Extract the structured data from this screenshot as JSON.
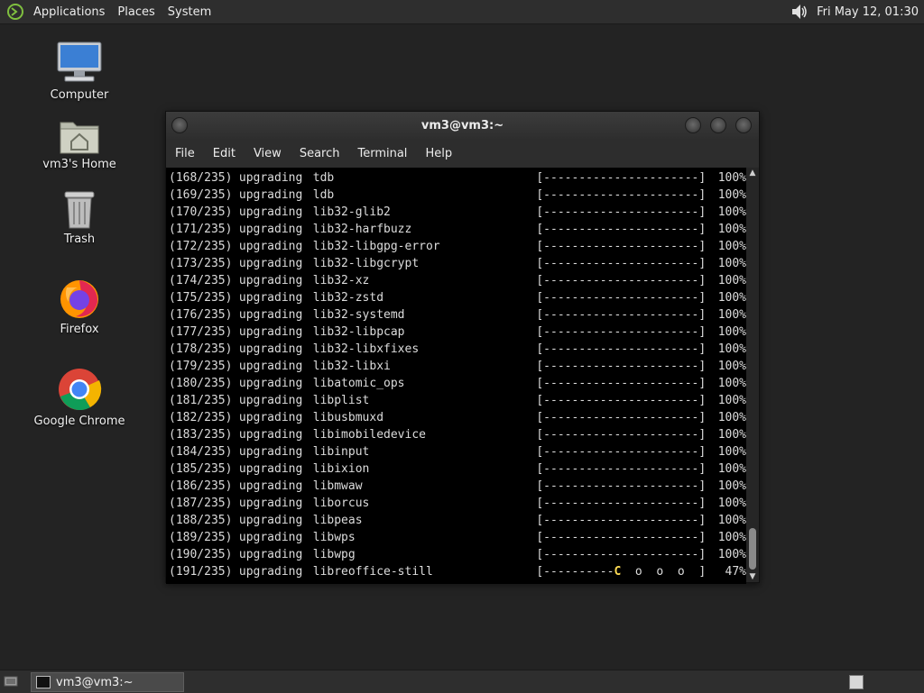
{
  "top_panel": {
    "menus": [
      "Applications",
      "Places",
      "System"
    ],
    "clock": "Fri May 12, 01:30"
  },
  "desktop_icons": [
    {
      "label": "Computer",
      "icon": "computer-icon"
    },
    {
      "label": "vm3's Home",
      "icon": "home-folder-icon"
    },
    {
      "label": "Trash",
      "icon": "trash-icon"
    },
    {
      "label": "Firefox",
      "icon": "firefox-icon"
    },
    {
      "label": "Google Chrome",
      "icon": "chrome-icon"
    }
  ],
  "terminal": {
    "title": "vm3@vm3:~",
    "menu": [
      "File",
      "Edit",
      "View",
      "Search",
      "Terminal",
      "Help"
    ],
    "lines": [
      {
        "num": "(168/235)",
        "action": "upgrading",
        "pkg": "tdb",
        "bar": "[----------------------]",
        "pct": "100%"
      },
      {
        "num": "(169/235)",
        "action": "upgrading",
        "pkg": "ldb",
        "bar": "[----------------------]",
        "pct": "100%"
      },
      {
        "num": "(170/235)",
        "action": "upgrading",
        "pkg": "lib32-glib2",
        "bar": "[----------------------]",
        "pct": "100%"
      },
      {
        "num": "(171/235)",
        "action": "upgrading",
        "pkg": "lib32-harfbuzz",
        "bar": "[----------------------]",
        "pct": "100%"
      },
      {
        "num": "(172/235)",
        "action": "upgrading",
        "pkg": "lib32-libgpg-error",
        "bar": "[----------------------]",
        "pct": "100%"
      },
      {
        "num": "(173/235)",
        "action": "upgrading",
        "pkg": "lib32-libgcrypt",
        "bar": "[----------------------]",
        "pct": "100%"
      },
      {
        "num": "(174/235)",
        "action": "upgrading",
        "pkg": "lib32-xz",
        "bar": "[----------------------]",
        "pct": "100%"
      },
      {
        "num": "(175/235)",
        "action": "upgrading",
        "pkg": "lib32-zstd",
        "bar": "[----------------------]",
        "pct": "100%"
      },
      {
        "num": "(176/235)",
        "action": "upgrading",
        "pkg": "lib32-systemd",
        "bar": "[----------------------]",
        "pct": "100%"
      },
      {
        "num": "(177/235)",
        "action": "upgrading",
        "pkg": "lib32-libpcap",
        "bar": "[----------------------]",
        "pct": "100%"
      },
      {
        "num": "(178/235)",
        "action": "upgrading",
        "pkg": "lib32-libxfixes",
        "bar": "[----------------------]",
        "pct": "100%"
      },
      {
        "num": "(179/235)",
        "action": "upgrading",
        "pkg": "lib32-libxi",
        "bar": "[----------------------]",
        "pct": "100%"
      },
      {
        "num": "(180/235)",
        "action": "upgrading",
        "pkg": "libatomic_ops",
        "bar": "[----------------------]",
        "pct": "100%"
      },
      {
        "num": "(181/235)",
        "action": "upgrading",
        "pkg": "libplist",
        "bar": "[----------------------]",
        "pct": "100%"
      },
      {
        "num": "(182/235)",
        "action": "upgrading",
        "pkg": "libusbmuxd",
        "bar": "[----------------------]",
        "pct": "100%"
      },
      {
        "num": "(183/235)",
        "action": "upgrading",
        "pkg": "libimobiledevice",
        "bar": "[----------------------]",
        "pct": "100%"
      },
      {
        "num": "(184/235)",
        "action": "upgrading",
        "pkg": "libinput",
        "bar": "[----------------------]",
        "pct": "100%"
      },
      {
        "num": "(185/235)",
        "action": "upgrading",
        "pkg": "libixion",
        "bar": "[----------------------]",
        "pct": "100%"
      },
      {
        "num": "(186/235)",
        "action": "upgrading",
        "pkg": "libmwaw",
        "bar": "[----------------------]",
        "pct": "100%"
      },
      {
        "num": "(187/235)",
        "action": "upgrading",
        "pkg": "liborcus",
        "bar": "[----------------------]",
        "pct": "100%"
      },
      {
        "num": "(188/235)",
        "action": "upgrading",
        "pkg": "libpeas",
        "bar": "[----------------------]",
        "pct": "100%"
      },
      {
        "num": "(189/235)",
        "action": "upgrading",
        "pkg": "libwps",
        "bar": "[----------------------]",
        "pct": "100%"
      },
      {
        "num": "(190/235)",
        "action": "upgrading",
        "pkg": "libwpg",
        "bar": "[----------------------]",
        "pct": "100%"
      },
      {
        "num": "(191/235)",
        "action": "upgrading",
        "pkg": "libreoffice-still",
        "bar_done": "[----------",
        "bar_head": "C",
        "bar_rest": "  o  o  o  ]",
        "pct": "47%"
      }
    ]
  },
  "taskbar": {
    "task_label": "vm3@vm3:~"
  },
  "colors": {
    "panel": "#2e2e2e",
    "desktop": "#232323",
    "terminal_bg": "#000000",
    "pacman": "#ffdd55"
  }
}
